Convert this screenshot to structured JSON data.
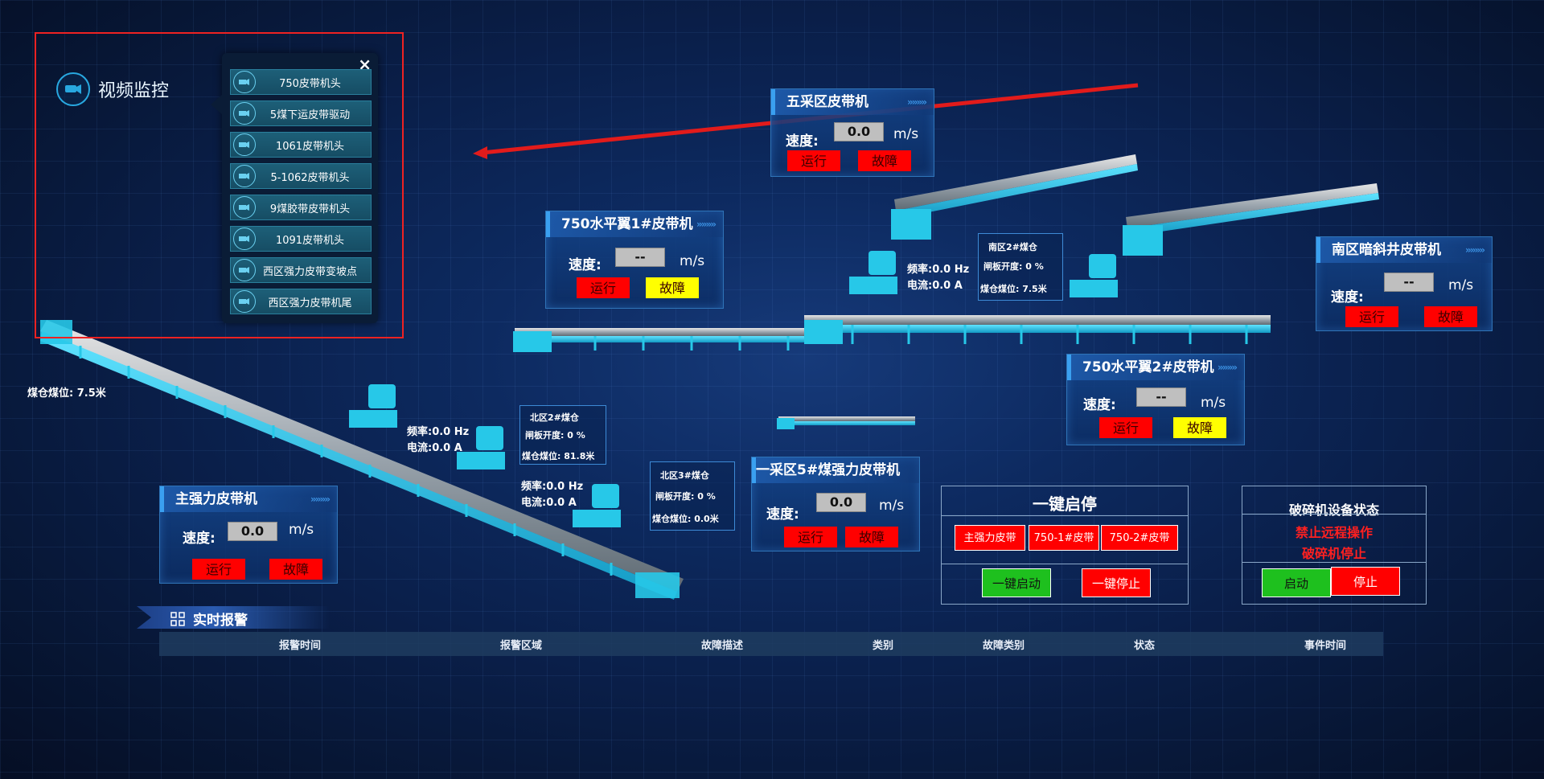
{
  "video": {
    "title": "视频监控",
    "close": "×",
    "cameras": [
      "750皮带机头",
      "5煤下运皮带驱动",
      "1061皮带机头",
      "5-1062皮带机头",
      "9煤胶带皮带机头",
      "1091皮带机头",
      "西区强力皮带变坡点",
      "西区强力皮带机尾"
    ]
  },
  "belts": {
    "wucai": {
      "title": "五采区皮带机",
      "speed_label": "速度:",
      "speed": "0.0",
      "unit": "m/s",
      "run": "运行",
      "fault": "故障"
    },
    "h750_1": {
      "title": "750水平翼1#皮带机",
      "speed_label": "速度:",
      "speed": "--",
      "unit": "m/s",
      "run": "运行",
      "fault": "故障"
    },
    "nanqu": {
      "title": "南区暗斜井皮带机",
      "speed_label": "速度:",
      "speed": "--",
      "unit": "m/s",
      "run": "运行",
      "fault": "故障"
    },
    "h750_2": {
      "title": "750水平翼2#皮带机",
      "speed_label": "速度:",
      "speed": "--",
      "unit": "m/s",
      "run": "运行",
      "fault": "故障"
    },
    "yicai": {
      "title": "一采区5#煤强力皮带机",
      "speed_label": "速度:",
      "speed": "0.0",
      "unit": "m/s",
      "run": "运行",
      "fault": "故障"
    },
    "main": {
      "title": "主强力皮带机",
      "speed_label": "速度:",
      "speed": "0.0",
      "unit": "m/s",
      "run": "运行",
      "fault": "故障"
    }
  },
  "bunkers": {
    "nanqu2": {
      "name": "南区2#煤仓",
      "gate": "闸板开度: 0 %",
      "level": "煤仓煤位: 7.5米"
    },
    "beiqu2": {
      "name": "北区2#煤仓",
      "gate": "闸板开度: 0 %",
      "level": "煤仓煤位: 81.8米"
    },
    "beiqu3": {
      "name": "北区3#煤仓",
      "gate": "闸板开度: 0 %",
      "level": "煤仓煤位: 0.0米"
    }
  },
  "feeders": {
    "f1": {
      "freq": "频率:0.0 Hz",
      "current": "电流:0.0 A"
    },
    "f2": {
      "freq": "频率:0.0 Hz",
      "current": "电流:0.0 A"
    },
    "f3": {
      "freq": "频率:0.0 Hz",
      "current": "电流:0.0 A"
    }
  },
  "left_level": "煤仓煤位: 7.5米",
  "one_key": {
    "title": "一键启停",
    "belts": [
      "主强力皮带",
      "750-1#皮带",
      "750-2#皮带"
    ],
    "start": "一键启动",
    "stop": "一键停止"
  },
  "crusher": {
    "title": "破碎机设备状态",
    "status1": "禁止远程操作",
    "status2": "破碎机停止",
    "start": "启动",
    "stop": "停止"
  },
  "alarm": {
    "title": "实时报警",
    "columns": [
      "报警时间",
      "报警区域",
      "故障描述",
      "类别",
      "故障类别",
      "状态",
      "事件时间"
    ]
  },
  "colors": {
    "run_red": "#ff0000",
    "fault_yellow": "#ffff00",
    "belt_cyan": "#27c8e8",
    "alert_text": "#ff2020"
  }
}
